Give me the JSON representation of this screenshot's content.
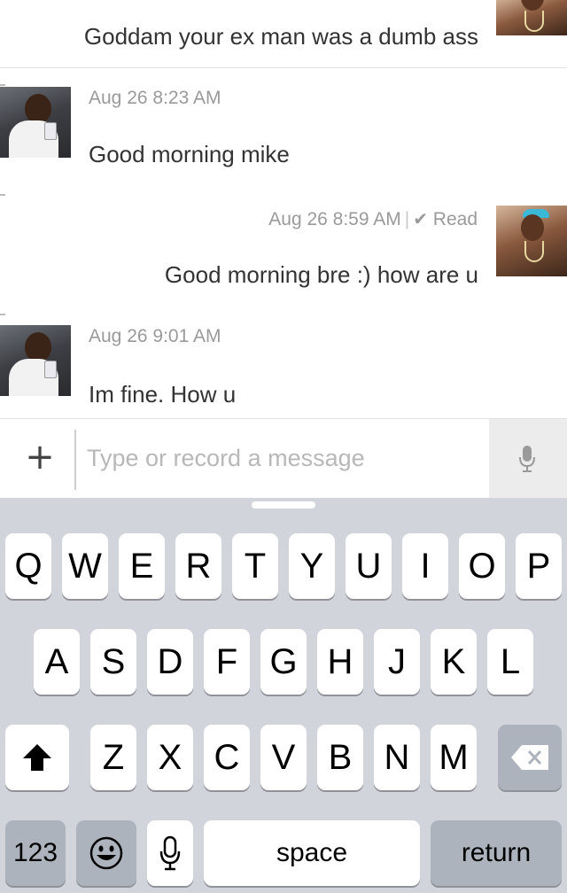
{
  "messages": [
    {
      "id": "m1",
      "side": "right",
      "meta": "",
      "read": "",
      "text": "Goddam your ex man was a dumb ass",
      "avatar": "contact-avatar"
    },
    {
      "id": "m2",
      "side": "left",
      "meta": "Aug 26 8:23 AM",
      "read": "",
      "text": "Good morning mike",
      "avatar": "user-avatar"
    },
    {
      "id": "m3",
      "side": "right",
      "meta": "Aug 26 8:59 AM",
      "read": "Read",
      "text": "Good morning bre :) how are u",
      "avatar": "contact-avatar"
    },
    {
      "id": "m4",
      "side": "left",
      "meta": "Aug 26 9:01 AM",
      "read": "",
      "text": "Im fine.  How u",
      "avatar": "user-avatar"
    }
  ],
  "composer": {
    "plus_icon": "plus-icon",
    "placeholder": "Type or record a message",
    "value": "",
    "mic_icon": "microphone-icon"
  },
  "keyboard": {
    "row1": [
      "Q",
      "W",
      "E",
      "R",
      "T",
      "Y",
      "U",
      "I",
      "O",
      "P"
    ],
    "row2": [
      "A",
      "S",
      "D",
      "F",
      "G",
      "H",
      "J",
      "K",
      "L"
    ],
    "row3": [
      "Z",
      "X",
      "C",
      "V",
      "B",
      "N",
      "M"
    ],
    "shift_icon": "shift-arrow-icon",
    "delete_icon": "delete-backspace-icon",
    "numbers_label": "123",
    "emoji_icon": "emoji-face-icon",
    "dictation_icon": "microphone-icon",
    "space_label": "space",
    "return_label": "return"
  },
  "colors": {
    "keyboard_bg": "#d1d5db",
    "key_light": "#ffffff",
    "key_dark": "#adb3bc",
    "meta_text": "#9a9a9a",
    "message_text": "#333333"
  }
}
